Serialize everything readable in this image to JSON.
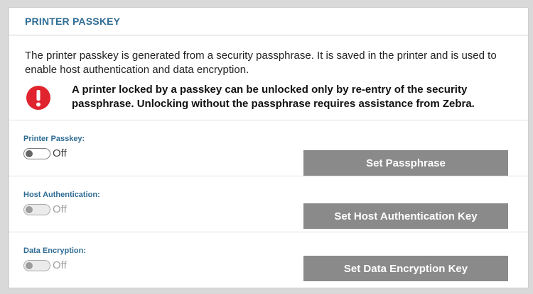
{
  "panel": {
    "title": "PRINTER PASSKEY",
    "description": "The printer passkey is generated from a security passphrase. It is saved in the printer and is used to enable host authentication and data encryption.",
    "warning": {
      "icon": "exclamation-icon",
      "color": "#e0242e",
      "text": "A printer locked by a passkey can be unlocked only by re-entry of the security passphrase. Unlocking without the passphrase requires assistance from Zebra."
    }
  },
  "settings": [
    {
      "label": "Printer Passkey:",
      "state": "Off",
      "enabled": true,
      "button": "Set Passphrase"
    },
    {
      "label": "Host Authentication:",
      "state": "Off",
      "enabled": false,
      "button": "Set Host Authentication Key"
    },
    {
      "label": "Data Encryption:",
      "state": "Off",
      "enabled": false,
      "button": "Set Data Encryption Key"
    }
  ],
  "colors": {
    "accent": "#2e6c94",
    "button": "#8a8a8a",
    "warning": "#e0242e"
  }
}
